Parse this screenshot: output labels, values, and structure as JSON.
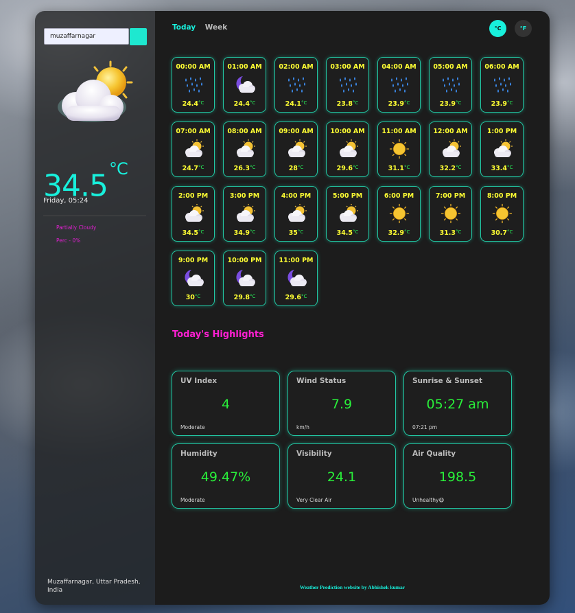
{
  "sidebar": {
    "search_value": "muzaffarnagar",
    "temperature": "34.5",
    "temp_unit": "°C",
    "day_time": "Friday, 05:24",
    "condition": "Partially Cloudy",
    "precipitation": "Perc - 0%",
    "location": "Muzaffarnagar, Uttar Pradesh, India",
    "icon": "partly-cloudy-day-icon"
  },
  "header": {
    "tabs": [
      {
        "label": "Today",
        "active": true
      },
      {
        "label": "Week",
        "active": false
      }
    ],
    "units": {
      "celsius": "°C",
      "fahrenheit": "°F"
    }
  },
  "hourly": [
    {
      "time": "00:00 AM",
      "temp": "24.4",
      "unit": "°C",
      "icon": "rain"
    },
    {
      "time": "01:00 AM",
      "temp": "24.4",
      "unit": "°C",
      "icon": "night-cloud"
    },
    {
      "time": "02:00 AM",
      "temp": "24.1",
      "unit": "°C",
      "icon": "rain"
    },
    {
      "time": "03:00 AM",
      "temp": "23.8",
      "unit": "°C",
      "icon": "rain"
    },
    {
      "time": "04:00 AM",
      "temp": "23.9",
      "unit": "°C",
      "icon": "rain"
    },
    {
      "time": "05:00 AM",
      "temp": "23.9",
      "unit": "°C",
      "icon": "rain"
    },
    {
      "time": "06:00 AM",
      "temp": "23.9",
      "unit": "°C",
      "icon": "rain"
    },
    {
      "time": "07:00 AM",
      "temp": "24.7",
      "unit": "°C",
      "icon": "partly-cloudy"
    },
    {
      "time": "08:00 AM",
      "temp": "26.3",
      "unit": "°C",
      "icon": "partly-cloudy"
    },
    {
      "time": "09:00 AM",
      "temp": "28",
      "unit": "°C",
      "icon": "partly-cloudy"
    },
    {
      "time": "10:00 AM",
      "temp": "29.6",
      "unit": "°C",
      "icon": "partly-cloudy"
    },
    {
      "time": "11:00 AM",
      "temp": "31.1",
      "unit": "°C",
      "icon": "sun"
    },
    {
      "time": "12:00 AM",
      "temp": "32.2",
      "unit": "°C",
      "icon": "partly-cloudy"
    },
    {
      "time": "1:00 PM",
      "temp": "33.4",
      "unit": "°C",
      "icon": "partly-cloudy"
    },
    {
      "time": "2:00 PM",
      "temp": "34.5",
      "unit": "°C",
      "icon": "partly-cloudy"
    },
    {
      "time": "3:00 PM",
      "temp": "34.9",
      "unit": "°C",
      "icon": "partly-cloudy"
    },
    {
      "time": "4:00 PM",
      "temp": "35",
      "unit": "°C",
      "icon": "partly-cloudy"
    },
    {
      "time": "5:00 PM",
      "temp": "34.5",
      "unit": "°C",
      "icon": "partly-cloudy"
    },
    {
      "time": "6:00 PM",
      "temp": "32.9",
      "unit": "°C",
      "icon": "sun"
    },
    {
      "time": "7:00 PM",
      "temp": "31.3",
      "unit": "°C",
      "icon": "sun"
    },
    {
      "time": "8:00 PM",
      "temp": "30.7",
      "unit": "°C",
      "icon": "sun"
    },
    {
      "time": "9:00 PM",
      "temp": "30",
      "unit": "°C",
      "icon": "night-cloud"
    },
    {
      "time": "10:00 PM",
      "temp": "29.8",
      "unit": "°C",
      "icon": "night-cloud"
    },
    {
      "time": "11:00 PM",
      "temp": "29.6",
      "unit": "°C",
      "icon": "night-cloud"
    }
  ],
  "highlights": {
    "title": "Today's Highlights",
    "cards": [
      {
        "title": "UV Index",
        "value": "4",
        "sub": "Moderate"
      },
      {
        "title": "Wind Status",
        "value": "7.9",
        "sub": "km/h"
      },
      {
        "title": "Sunrise & Sunset",
        "value": "05:27 am",
        "sub": "07:21 pm"
      },
      {
        "title": "Humidity",
        "value": "49.47%",
        "sub": "Moderate"
      },
      {
        "title": "Visibility",
        "value": "24.1",
        "sub": "Very Clear Air"
      },
      {
        "title": "Air Quality",
        "value": "198.5",
        "sub": "Unhealthy😷"
      }
    ]
  },
  "footer": "Weather Prediction website by Abhishek kumar",
  "colors": {
    "accent": "#18f0dc",
    "hour_text": "#ffff33",
    "value_green": "#29f03a",
    "highlight_title": "#ff1fd3",
    "condition_text": "#e020d0"
  }
}
